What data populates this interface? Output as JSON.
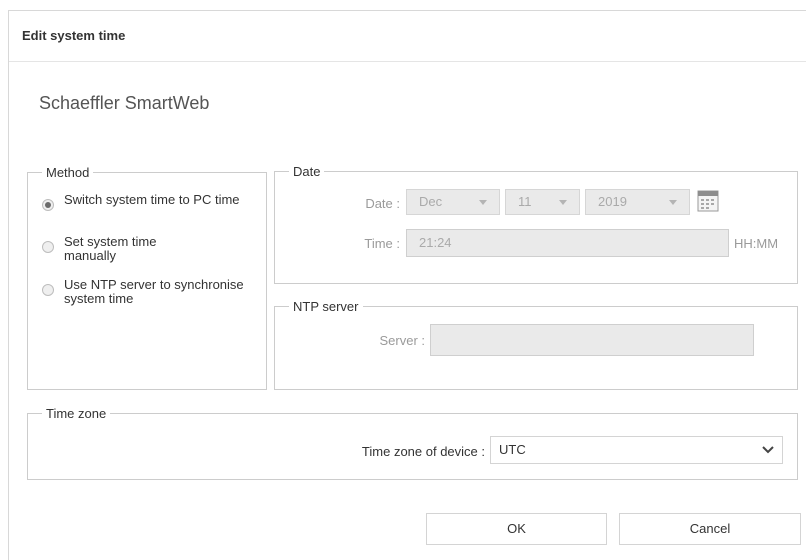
{
  "dialog": {
    "title": "Edit system time"
  },
  "app": {
    "name": "Schaeffler SmartWeb"
  },
  "method": {
    "legend": "Method",
    "options": [
      {
        "label": "Switch system time to PC time",
        "checked": true
      },
      {
        "label": "Set system time manually",
        "checked": false
      },
      {
        "label": "Use NTP server to synchronise system time",
        "checked": false
      }
    ]
  },
  "date": {
    "legend": "Date",
    "date_label": "Date :",
    "month": "Dec",
    "day": "11",
    "year": "2019",
    "time_label": "Time :",
    "time_value": "21:24",
    "time_unit": "HH:MM",
    "calendar_icon": "calendar-icon"
  },
  "ntp": {
    "legend": "NTP server",
    "server_label": "Server :",
    "server_value": ""
  },
  "timezone": {
    "legend": "Time zone",
    "label": "Time zone of device :",
    "value": "UTC",
    "chevron_icon": "chevron-down-icon"
  },
  "buttons": {
    "ok": "OK",
    "cancel": "Cancel"
  }
}
